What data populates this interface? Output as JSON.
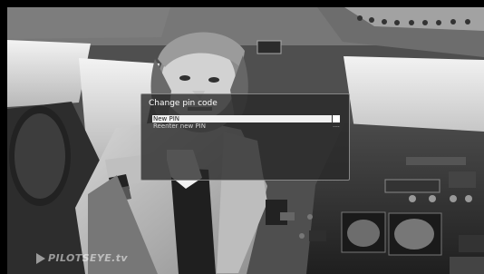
{
  "dialog": {
    "title": "Change pin code",
    "fields": [
      {
        "label": "New PIN",
        "value": "",
        "selected": true
      },
      {
        "label": "Reenter new PIN",
        "value": "....",
        "selected": false
      }
    ]
  },
  "watermark": {
    "text": "PILOTSEYE.tv"
  },
  "colors": {
    "dialog_background": "#282828",
    "dialog_border": "#a5a5a5",
    "selected_row": "#f1f1f1",
    "title_text": "#ffffff",
    "normal_text": "#d5d5d5"
  },
  "icons": {
    "watermark": "play-arrow-icon"
  }
}
